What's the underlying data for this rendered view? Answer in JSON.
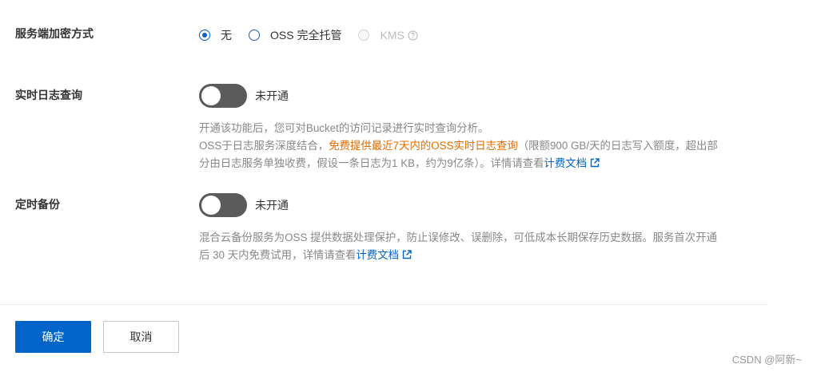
{
  "encryption": {
    "label": "服务端加密方式",
    "options": [
      {
        "label": "无",
        "state": "checked"
      },
      {
        "label": "OSS 完全托管",
        "state": "unchecked"
      },
      {
        "label": "KMS",
        "state": "disabled"
      }
    ]
  },
  "realtime_log": {
    "label": "实时日志查询",
    "status": "未开通",
    "enabled": false,
    "desc_line1": "开通该功能后，您可对Bucket的访问记录进行实时查询分析。",
    "desc_pre": "OSS于日志服务深度结合，",
    "desc_highlight": "免费提供最近7天内的OSS实时日志查询",
    "desc_post": "（限额900 GB/天的日志写入额度，超出部分由日志服务单独收费，假设一条日志为1 KB，约为9亿条）。详情请查看",
    "link_label": "计费文档"
  },
  "backup": {
    "label": "定时备份",
    "status": "未开通",
    "enabled": false,
    "desc_pre": "混合云备份服务为OSS 提供数据处理保护，防止误修改、误删除，可低成本长期保存历史数据。服务首次开通后 30 天内免费试用，详情请查看",
    "link_label": "计费文档"
  },
  "footer": {
    "confirm_label": "确定",
    "cancel_label": "取消"
  },
  "watermark": "CSDN @阿新~",
  "colors": {
    "primary": "#0064c8",
    "highlight": "#e46b00",
    "switch_off": "#5b5b5b"
  }
}
